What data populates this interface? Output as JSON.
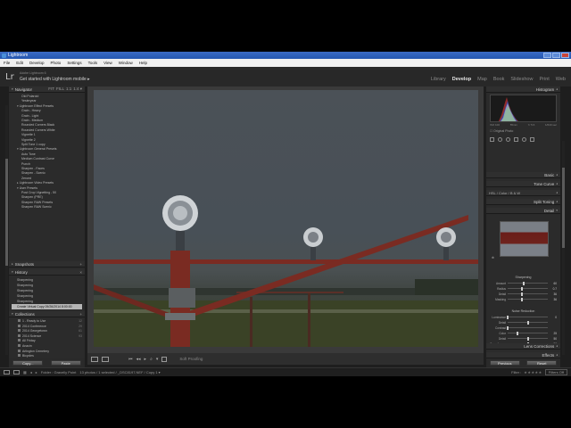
{
  "window": {
    "title": "Lightroom"
  },
  "menu": [
    "File",
    "Edit",
    "Develop",
    "Photo",
    "Settings",
    "Tools",
    "View",
    "Window",
    "Help"
  ],
  "identity": {
    "logo": "Lr",
    "product": "Adobe Lightroom 6",
    "mobile": "Get started with Lightroom mobile ▸"
  },
  "modules": [
    "Library",
    "Develop",
    "Map",
    "Book",
    "Slideshow",
    "Print",
    "Web"
  ],
  "active_module": "Develop",
  "left": {
    "navigator": {
      "title": "Navigator",
      "zoom": [
        "FIT",
        "FILL",
        "1:1",
        "1:4 ▾"
      ]
    },
    "presets": [
      {
        "label": "Old Polaroid",
        "indent": 2,
        "tri": ""
      },
      {
        "label": "Yesteryear",
        "indent": 2,
        "tri": ""
      },
      {
        "label": "Lightroom Effect Presets",
        "indent": 1,
        "tri": "▾"
      },
      {
        "label": "Grain - Heavy",
        "indent": 2,
        "tri": ""
      },
      {
        "label": "Grain - Light",
        "indent": 2,
        "tri": ""
      },
      {
        "label": "Grain - Medium",
        "indent": 2,
        "tri": ""
      },
      {
        "label": "Rounded Corners Black",
        "indent": 2,
        "tri": ""
      },
      {
        "label": "Rounded Corners White",
        "indent": 2,
        "tri": ""
      },
      {
        "label": "Vignette 1",
        "indent": 2,
        "tri": ""
      },
      {
        "label": "Vignette 2",
        "indent": 2,
        "tri": ""
      },
      {
        "label": "Split Tone 1 copy",
        "indent": 2,
        "tri": ""
      },
      {
        "label": "Lightroom General Presets",
        "indent": 1,
        "tri": "▾"
      },
      {
        "label": "Auto Tone",
        "indent": 2,
        "tri": ""
      },
      {
        "label": "Medium Contrast Curve",
        "indent": 2,
        "tri": ""
      },
      {
        "label": "Punch",
        "indent": 2,
        "tri": ""
      },
      {
        "label": "Sharpen - Faces",
        "indent": 2,
        "tri": ""
      },
      {
        "label": "Sharpen - Scenic",
        "indent": 2,
        "tri": ""
      },
      {
        "label": "Zeroed",
        "indent": 2,
        "tri": ""
      },
      {
        "label": "Lightroom Video Presets",
        "indent": 1,
        "tri": "▸"
      },
      {
        "label": "User Presets",
        "indent": 1,
        "tri": "▾"
      },
      {
        "label": "Post Crop Vignetting - 50",
        "indent": 2,
        "tri": ""
      },
      {
        "label": "Sharpen (PRE)",
        "indent": 2,
        "tri": ""
      },
      {
        "label": "Sharpen RAW Presets",
        "indent": 2,
        "tri": ""
      },
      {
        "label": "Sharpen RAW Scenic",
        "indent": 2,
        "tri": ""
      }
    ],
    "snapshots": {
      "title": "Snapshots",
      "add": "+"
    },
    "history": {
      "title": "History",
      "clear": "×",
      "items": [
        {
          "label": "Sharpening",
          "selected": false
        },
        {
          "label": "Sharpening",
          "selected": false
        },
        {
          "label": "Sharpening",
          "selected": false
        },
        {
          "label": "Sharpening",
          "selected": false
        },
        {
          "label": "Sharpening",
          "selected": false
        },
        {
          "label": "Create Virtual Copy 09/26/2014 8:00:00",
          "selected": true
        }
      ]
    },
    "collections": {
      "title": "Collections",
      "add": "+",
      "items": [
        {
          "label": "1 - Ready to Use",
          "count": "12"
        },
        {
          "label": "2014 Conference",
          "count": "29"
        },
        {
          "label": "2014 Georgetown",
          "count": "61"
        },
        {
          "label": "2014 Science",
          "count": "93"
        },
        {
          "label": "All Friday",
          "count": ""
        },
        {
          "label": "Anacin",
          "count": ""
        },
        {
          "label": "Arlington Cemetery",
          "count": ""
        },
        {
          "label": "Bicycles",
          "count": ""
        },
        {
          "label": "Black Pond Film",
          "count": ""
        }
      ]
    },
    "copy_label": "Copy...",
    "paste_label": "Paste"
  },
  "toolbar": {
    "play": "▸",
    "soft_proofing": "Soft Proofing"
  },
  "right": {
    "histogram": {
      "title": "Histogram",
      "info": [
        "ISO 100",
        "55mm",
        "f / 5.6",
        "1/640 sec"
      ],
      "original": "☐ Original Photo"
    },
    "sections": [
      {
        "label": "Basic"
      },
      {
        "label": "Tone Curve"
      },
      {
        "label": "HSL / Color / B & W",
        "short": "HSL  /  Color  /  B & W"
      },
      {
        "label": "Split Toning"
      },
      {
        "label": "Detail"
      }
    ],
    "detail": {
      "sharpening": "Sharpening",
      "sliders": [
        {
          "label": "Amount",
          "value": "60",
          "pos": 0.4
        },
        {
          "label": "Radius",
          "value": "0.7",
          "pos": 0.35
        },
        {
          "label": "Detail",
          "value": "36",
          "pos": 0.36
        },
        {
          "label": "Masking",
          "value": "36",
          "pos": 0.36
        }
      ],
      "noise": "Noise Reduction",
      "noise_sliders": [
        {
          "label": "Luminance",
          "value": "0",
          "pos": 0
        },
        {
          "label": "Detail",
          "value": "",
          "pos": 0.5
        },
        {
          "label": "Contrast",
          "value": "",
          "pos": 0
        },
        {
          "label": "Color",
          "value": "25",
          "pos": 0.25
        },
        {
          "label": "Detail",
          "value": "50",
          "pos": 0.5
        },
        {
          "label": "Smoothness",
          "value": "50",
          "pos": 0.5
        }
      ]
    },
    "lens": "Lens Corrections",
    "effects": "Effects",
    "previous_label": "Previous",
    "reset_label": "Reset"
  },
  "filmstrip": {
    "pages": [
      "1",
      "2"
    ],
    "path": "Folder : Gravelly Point",
    "info": "13 photos / 1 selected / _DSC8197.NEF / Copy 1 ▾",
    "filter_label": "Filter :",
    "stars": "★★★★★",
    "filter_state": "Filters Off"
  },
  "colors": {
    "panel": "#2b2b2b",
    "center": "#3a3a3a",
    "titlebar": "#2456b0",
    "accent_red": "#7a1e19"
  }
}
